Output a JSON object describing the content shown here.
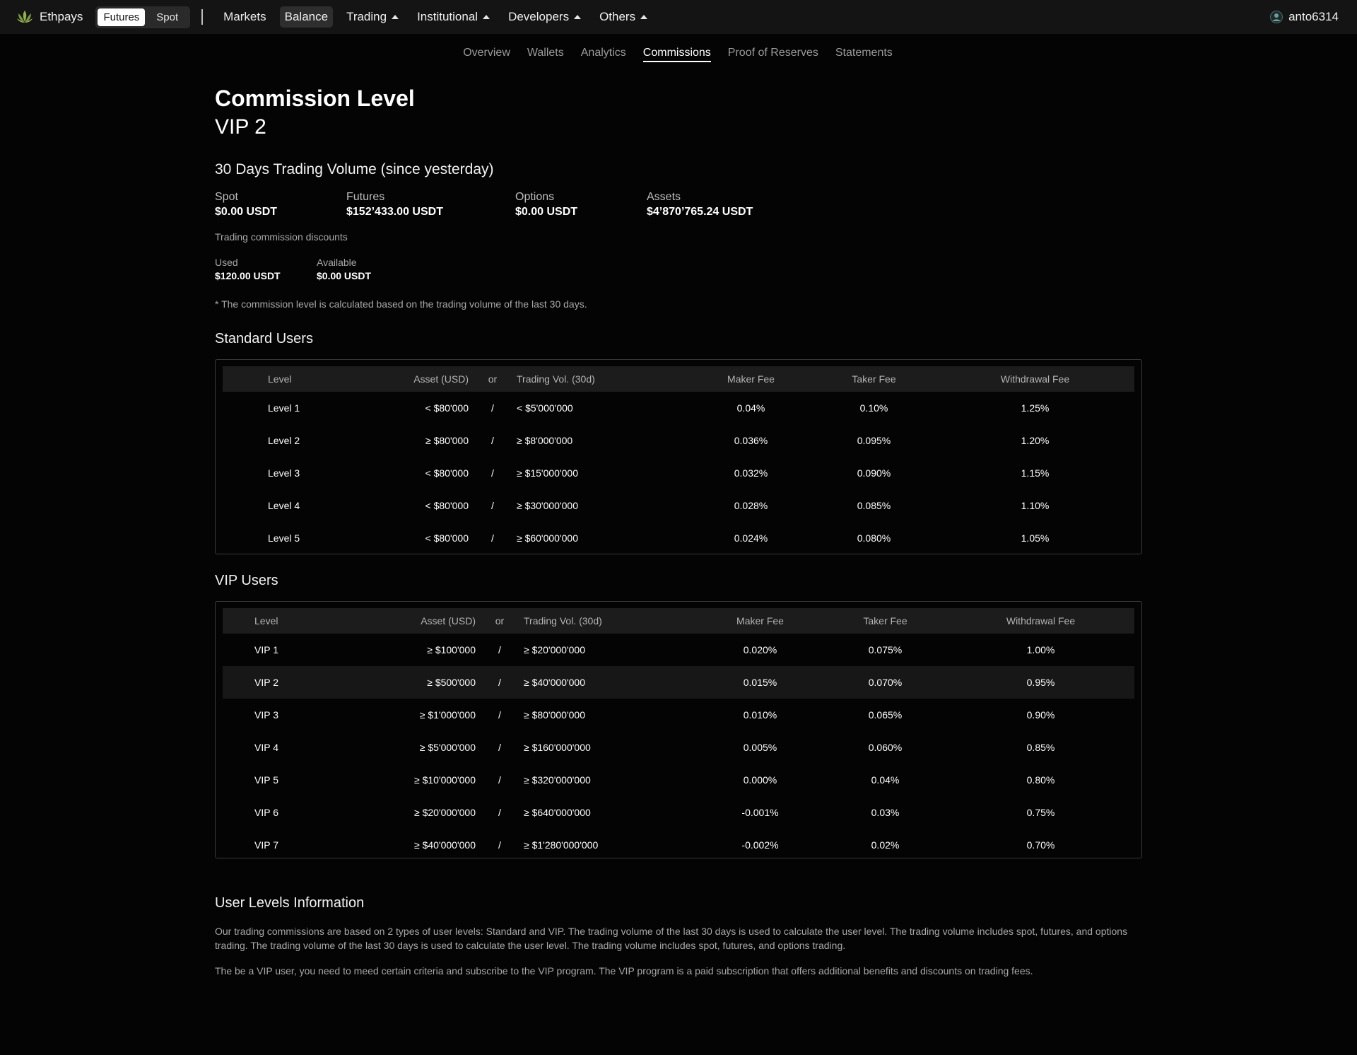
{
  "app": {
    "brand": "Ethpays",
    "modes": [
      "Futures",
      "Spot"
    ],
    "nav": {
      "markets": "Markets",
      "balance": "Balance",
      "trading": "Trading",
      "institutional": "Institutional",
      "developers": "Developers",
      "others": "Others"
    },
    "user": "anto6314"
  },
  "subnav": [
    "Overview",
    "Wallets",
    "Analytics",
    "Commissions",
    "Proof of Reserves",
    "Statements"
  ],
  "page": {
    "title": "Commission Level",
    "level": "VIP 2",
    "volume_title": "30 Days Trading Volume (since yesterday)",
    "stats": [
      {
        "label": "Spot",
        "value": "$0.00 USDT"
      },
      {
        "label": "Futures",
        "value": "$152’433.00 USDT"
      },
      {
        "label": "Options",
        "value": "$0.00 USDT"
      },
      {
        "label": "Assets",
        "value": "$4’870’765.24 USDT"
      }
    ],
    "discounts_title": "Trading commission discounts",
    "discounts": [
      {
        "label": "Used",
        "value": "$120.00 USDT"
      },
      {
        "label": "Available",
        "value": "$0.00 USDT"
      }
    ],
    "note": "* The commission level is calculated based on the trading volume of the last 30 days."
  },
  "standard": {
    "title": "Standard Users",
    "headers": [
      "Level",
      "Asset (USD)",
      "or",
      "Trading Vol. (30d)",
      "Maker Fee",
      "Taker Fee",
      "Withdrawal Fee"
    ],
    "rows": [
      [
        "Level 1",
        "< $80'000",
        "/",
        "< $5'000'000",
        "0.04%",
        "0.10%",
        "1.25%"
      ],
      [
        "Level 2",
        "≥ $80'000",
        "/",
        "≥ $8'000'000",
        "0.036%",
        "0.095%",
        "1.20%"
      ],
      [
        "Level 3",
        "< $80'000",
        "/",
        "≥ $15'000'000",
        "0.032%",
        "0.090%",
        "1.15%"
      ],
      [
        "Level 4",
        "< $80'000",
        "/",
        "≥ $30'000'000",
        "0.028%",
        "0.085%",
        "1.10%"
      ],
      [
        "Level 5",
        "< $80'000",
        "/",
        "≥ $60'000'000",
        "0.024%",
        "0.080%",
        "1.05%"
      ]
    ]
  },
  "vip": {
    "title": "VIP Users",
    "headers": [
      "Level",
      "Asset (USD)",
      "or",
      "Trading Vol. (30d)",
      "Maker Fee",
      "Taker Fee",
      "Withdrawal Fee"
    ],
    "rows": [
      [
        "VIP 1",
        "≥ $100'000",
        "/",
        "≥ $20'000'000",
        "0.020%",
        "0.075%",
        "1.00%"
      ],
      [
        "VIP 2",
        "≥ $500'000",
        "/",
        "≥ $40'000'000",
        "0.015%",
        "0.070%",
        "0.95%"
      ],
      [
        "VIP 3",
        "≥ $1'000'000",
        "/",
        "≥ $80'000'000",
        "0.010%",
        "0.065%",
        "0.90%"
      ],
      [
        "VIP 4",
        "≥ $5'000'000",
        "/",
        "≥ $160'000'000",
        "0.005%",
        "0.060%",
        "0.85%"
      ],
      [
        "VIP 5",
        "≥ $10'000'000",
        "/",
        "≥ $320'000'000",
        "0.000%",
        "0.04%",
        "0.80%"
      ],
      [
        "VIP 6",
        "≥ $20'000'000",
        "/",
        "≥ $640'000'000",
        "-0.001%",
        "0.03%",
        "0.75%"
      ],
      [
        "VIP 7",
        "≥ $40'000'000",
        "/",
        "≥ $1'280'000'000",
        "-0.002%",
        "0.02%",
        "0.70%"
      ]
    ]
  },
  "info": {
    "title": "User Levels Information",
    "paragraphs": [
      "Our trading commissions are based on 2 types of user levels: Standard and VIP. The trading volume of the last 30 days is used to calculate the user level. The trading volume includes spot, futures, and options trading. The trading volume of the last 30 days is used to calculate the user level. The trading volume includes spot, futures, and options trading.",
      "The be a VIP user, you need to meed certain criteria and subscribe to the VIP program. The VIP program is a paid subscription that offers additional benefits and discounts on trading fees."
    ]
  },
  "colors": {
    "background": "#040404",
    "topbar": "#141414",
    "logo": "#8fb24a"
  },
  "icons": {
    "logo": "lotus-logo-icon",
    "caret": "caret-up-icon",
    "avatar": "user-avatar-icon"
  }
}
